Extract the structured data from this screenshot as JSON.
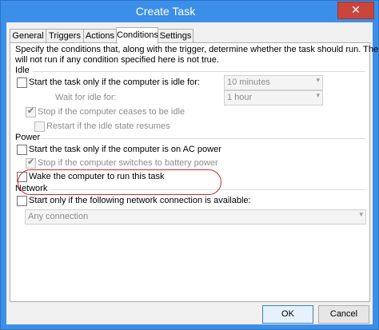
{
  "window": {
    "title": "Create Task",
    "close_glyph": "✕"
  },
  "tabs": [
    {
      "label": "General"
    },
    {
      "label": "Triggers"
    },
    {
      "label": "Actions"
    },
    {
      "label": "Conditions"
    },
    {
      "label": "Settings"
    }
  ],
  "intro": {
    "line1": "Specify the conditions that, along with the trigger, determine whether the task should run.  The task",
    "line2": "will not run  if any condition specified here is not true."
  },
  "idle": {
    "heading": "Idle",
    "start_only_if_idle": {
      "label": "Start the task only if the computer is idle for:",
      "checked": false
    },
    "idle_duration": {
      "value": "10 minutes"
    },
    "wait_for_idle_label": "Wait for idle for:",
    "wait_duration": {
      "value": "1 hour"
    },
    "stop_if_ceases_idle": {
      "label": "Stop if the computer ceases to be idle",
      "checked": true
    },
    "restart_if_resumes": {
      "label": "Restart if the idle state resumes",
      "checked": false
    }
  },
  "power": {
    "heading": "Power",
    "start_only_on_ac": {
      "label": "Start the task only if the computer is on AC power",
      "checked": false
    },
    "stop_on_battery": {
      "label": "Stop if the computer switches to battery power",
      "checked": true
    },
    "wake_to_run": {
      "label": "Wake the computer to run this task",
      "checked": false
    }
  },
  "network": {
    "heading": "Network",
    "start_only_if_network": {
      "label": "Start only if the following network connection is available:",
      "checked": false
    },
    "connection": {
      "value": "Any connection"
    }
  },
  "buttons": {
    "ok": "OK",
    "cancel": "Cancel"
  },
  "glyphs": {
    "check": "✔",
    "dropdown": "▾"
  },
  "colors": {
    "titlebar": "#3c8fe8",
    "close": "#c9463d",
    "highlight_oval": "#d02a2a"
  }
}
